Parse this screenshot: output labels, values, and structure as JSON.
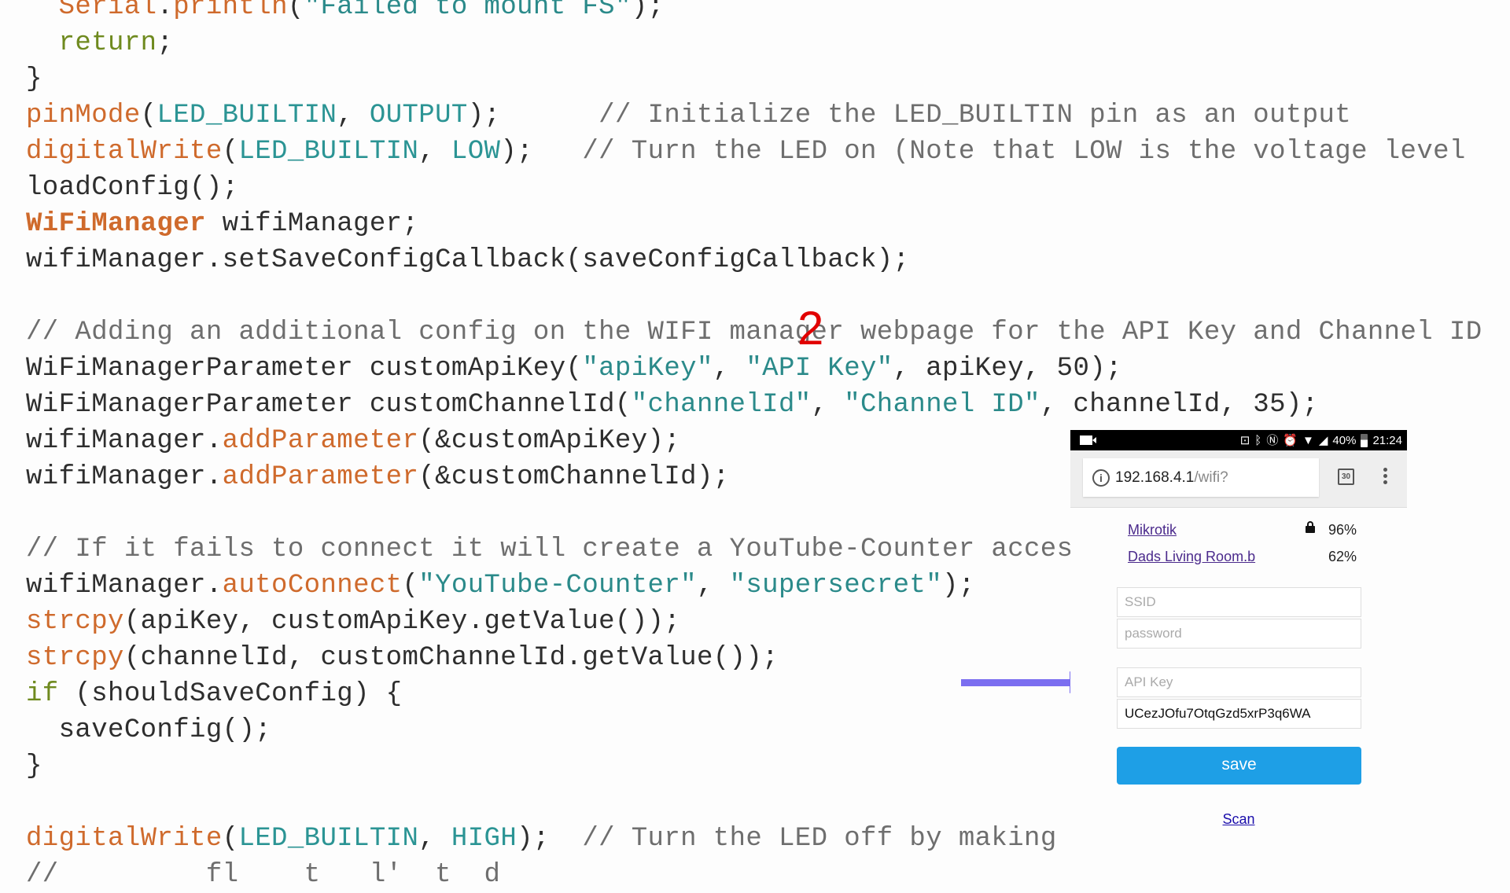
{
  "code": {
    "lines": [
      [
        {
          "t": "  ",
          "c": "plain"
        },
        {
          "t": "Serial",
          "c": "fn"
        },
        {
          "t": ".",
          "c": "plain"
        },
        {
          "t": "println",
          "c": "fn"
        },
        {
          "t": "(",
          "c": "plain"
        },
        {
          "t": "\"Failed to mount FS\"",
          "c": "str"
        },
        {
          "t": ");",
          "c": "plain"
        }
      ],
      [
        {
          "t": "  ",
          "c": "plain"
        },
        {
          "t": "return",
          "c": "kw"
        },
        {
          "t": ";",
          "c": "plain"
        }
      ],
      [
        {
          "t": "}",
          "c": "plain"
        }
      ],
      [
        {
          "t": "pinMode",
          "c": "fn"
        },
        {
          "t": "(",
          "c": "plain"
        },
        {
          "t": "LED_BUILTIN",
          "c": "const"
        },
        {
          "t": ", ",
          "c": "plain"
        },
        {
          "t": "OUTPUT",
          "c": "const"
        },
        {
          "t": ");      ",
          "c": "plain"
        },
        {
          "t": "// Initialize the LED_BUILTIN pin as an output",
          "c": "cmt"
        }
      ],
      [
        {
          "t": "digitalWrite",
          "c": "fn"
        },
        {
          "t": "(",
          "c": "plain"
        },
        {
          "t": "LED_BUILTIN",
          "c": "const"
        },
        {
          "t": ", ",
          "c": "plain"
        },
        {
          "t": "LOW",
          "c": "const"
        },
        {
          "t": ");   ",
          "c": "plain"
        },
        {
          "t": "// Turn the LED on (Note that LOW is the voltage level",
          "c": "cmt"
        }
      ],
      [
        {
          "t": "loadConfig();",
          "c": "plain"
        }
      ],
      [
        {
          "t": "WiFiManager",
          "c": "cls"
        },
        {
          "t": " wifiManager;",
          "c": "plain"
        }
      ],
      [
        {
          "t": "wifiManager.setSaveConfigCallback(saveConfigCallback);",
          "c": "plain"
        }
      ],
      [],
      [
        {
          "t": "// Adding an additional config on the WIFI manager webpage for the API Key and Channel ID",
          "c": "cmt"
        }
      ],
      [
        {
          "t": "WiFiManagerParameter customApiKey(",
          "c": "plain"
        },
        {
          "t": "\"apiKey\"",
          "c": "str"
        },
        {
          "t": ", ",
          "c": "plain"
        },
        {
          "t": "\"API Key\"",
          "c": "str"
        },
        {
          "t": ", apiKey, 50);",
          "c": "plain"
        }
      ],
      [
        {
          "t": "WiFiManagerParameter customChannelId(",
          "c": "plain"
        },
        {
          "t": "\"channelId\"",
          "c": "str"
        },
        {
          "t": ", ",
          "c": "plain"
        },
        {
          "t": "\"Channel ID\"",
          "c": "str"
        },
        {
          "t": ", channelId, 35);",
          "c": "plain"
        }
      ],
      [
        {
          "t": "wifiManager.",
          "c": "plain"
        },
        {
          "t": "addParameter",
          "c": "fn"
        },
        {
          "t": "(&customApiKey);",
          "c": "plain"
        }
      ],
      [
        {
          "t": "wifiManager.",
          "c": "plain"
        },
        {
          "t": "addParameter",
          "c": "fn"
        },
        {
          "t": "(&customChannelId);",
          "c": "plain"
        }
      ],
      [],
      [
        {
          "t": "// If it fails to connect it will create a YouTube-Counter access",
          "c": "cmt"
        }
      ],
      [
        {
          "t": "wifiManager.",
          "c": "plain"
        },
        {
          "t": "autoConnect",
          "c": "fn"
        },
        {
          "t": "(",
          "c": "plain"
        },
        {
          "t": "\"YouTube-Counter\"",
          "c": "str"
        },
        {
          "t": ", ",
          "c": "plain"
        },
        {
          "t": "\"supersecret\"",
          "c": "str"
        },
        {
          "t": ");",
          "c": "plain"
        }
      ],
      [
        {
          "t": "strcpy",
          "c": "fn"
        },
        {
          "t": "(apiKey, customApiKey.getValue());",
          "c": "plain"
        }
      ],
      [
        {
          "t": "strcpy",
          "c": "fn"
        },
        {
          "t": "(channelId, customChannelId.getValue());",
          "c": "plain"
        }
      ],
      [
        {
          "t": "if",
          "c": "kw"
        },
        {
          "t": " (shouldSaveConfig) {",
          "c": "plain"
        }
      ],
      [
        {
          "t": "  saveConfig();",
          "c": "plain"
        }
      ],
      [
        {
          "t": "}",
          "c": "plain"
        }
      ],
      [],
      [
        {
          "t": "digitalWrite",
          "c": "fn"
        },
        {
          "t": "(",
          "c": "plain"
        },
        {
          "t": "LED_BUILTIN",
          "c": "const"
        },
        {
          "t": ", ",
          "c": "plain"
        },
        {
          "t": "HIGH",
          "c": "const"
        },
        {
          "t": ");  ",
          "c": "plain"
        },
        {
          "t": "// Turn the LED off by making t",
          "c": "cmt"
        }
      ],
      [
        {
          "t": "//         fl    t   l'  t  d   ",
          "c": "cmt"
        }
      ]
    ]
  },
  "annotation": {
    "marker_label": "2",
    "arrow_color": "#7b6ef0"
  },
  "phone": {
    "status_bar": {
      "left_icon": "video-camera-icon",
      "icons": [
        "cast-icon",
        "bluetooth-icon",
        "nfc-icon",
        "alarm-icon",
        "wifi-icon",
        "cell-signal-icon"
      ],
      "battery": "40%",
      "time": "21:24"
    },
    "browser": {
      "url_host": "192.168.4.1",
      "url_path": "/wifi?",
      "tab_count": "30"
    },
    "networks": [
      {
        "name": "Mikrotik",
        "locked": true,
        "signal": "96%"
      },
      {
        "name": "Dads Living Room.b",
        "locked": false,
        "signal": "62%"
      }
    ],
    "form": {
      "ssid_placeholder": "SSID",
      "password_placeholder": "password",
      "api_key_placeholder": "API Key",
      "channel_id_value": "UCezJOfu7OtqGzd5xrP3q6WA",
      "save_label": "save",
      "scan_label": "Scan"
    },
    "accent_color": "#1e9fe6"
  }
}
